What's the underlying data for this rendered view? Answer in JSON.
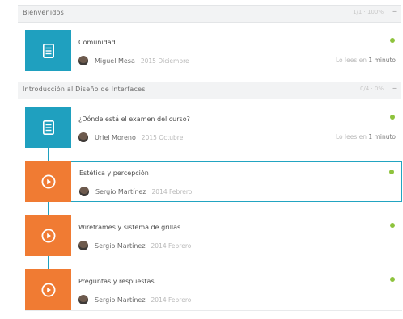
{
  "sections": [
    {
      "title": "Bienvenidos",
      "meta": "1/1 · 100%",
      "collapse": "–"
    },
    {
      "title": "Introducción al Diseño de Interfaces",
      "meta": "0/4 · 0%",
      "collapse": "–"
    }
  ],
  "items": [
    {
      "title": "Comunidad",
      "author": "Miguel Mesa",
      "date": "2015 Diciembre",
      "read_prefix": "Lo lees en",
      "read_time": "1 minuto",
      "type": "doc"
    },
    {
      "title": "¿Dónde está el examen del curso?",
      "author": "Uriel Moreno",
      "date": "2015 Octubre",
      "read_prefix": "Lo lees en",
      "read_time": "1 minuto",
      "type": "doc"
    },
    {
      "title": "Estética y percepción",
      "author": "Sergio Martínez",
      "date": "2014 Febrero",
      "type": "video"
    },
    {
      "title": "Wireframes y sistema de grillas",
      "author": "Sergio Martínez",
      "date": "2014 Febrero",
      "type": "video"
    },
    {
      "title": "Preguntas y respuestas",
      "author": "Sergio Martínez",
      "date": "2014 Febrero",
      "type": "video"
    }
  ],
  "colors": {
    "doc": "#1fa0bf",
    "video": "#f07b33",
    "selected_border": "#22a4c1",
    "status_dot": "#8ec33d"
  },
  "icons": {
    "doc": "document-icon",
    "video": "play-icon",
    "collapse": "minus-icon"
  }
}
